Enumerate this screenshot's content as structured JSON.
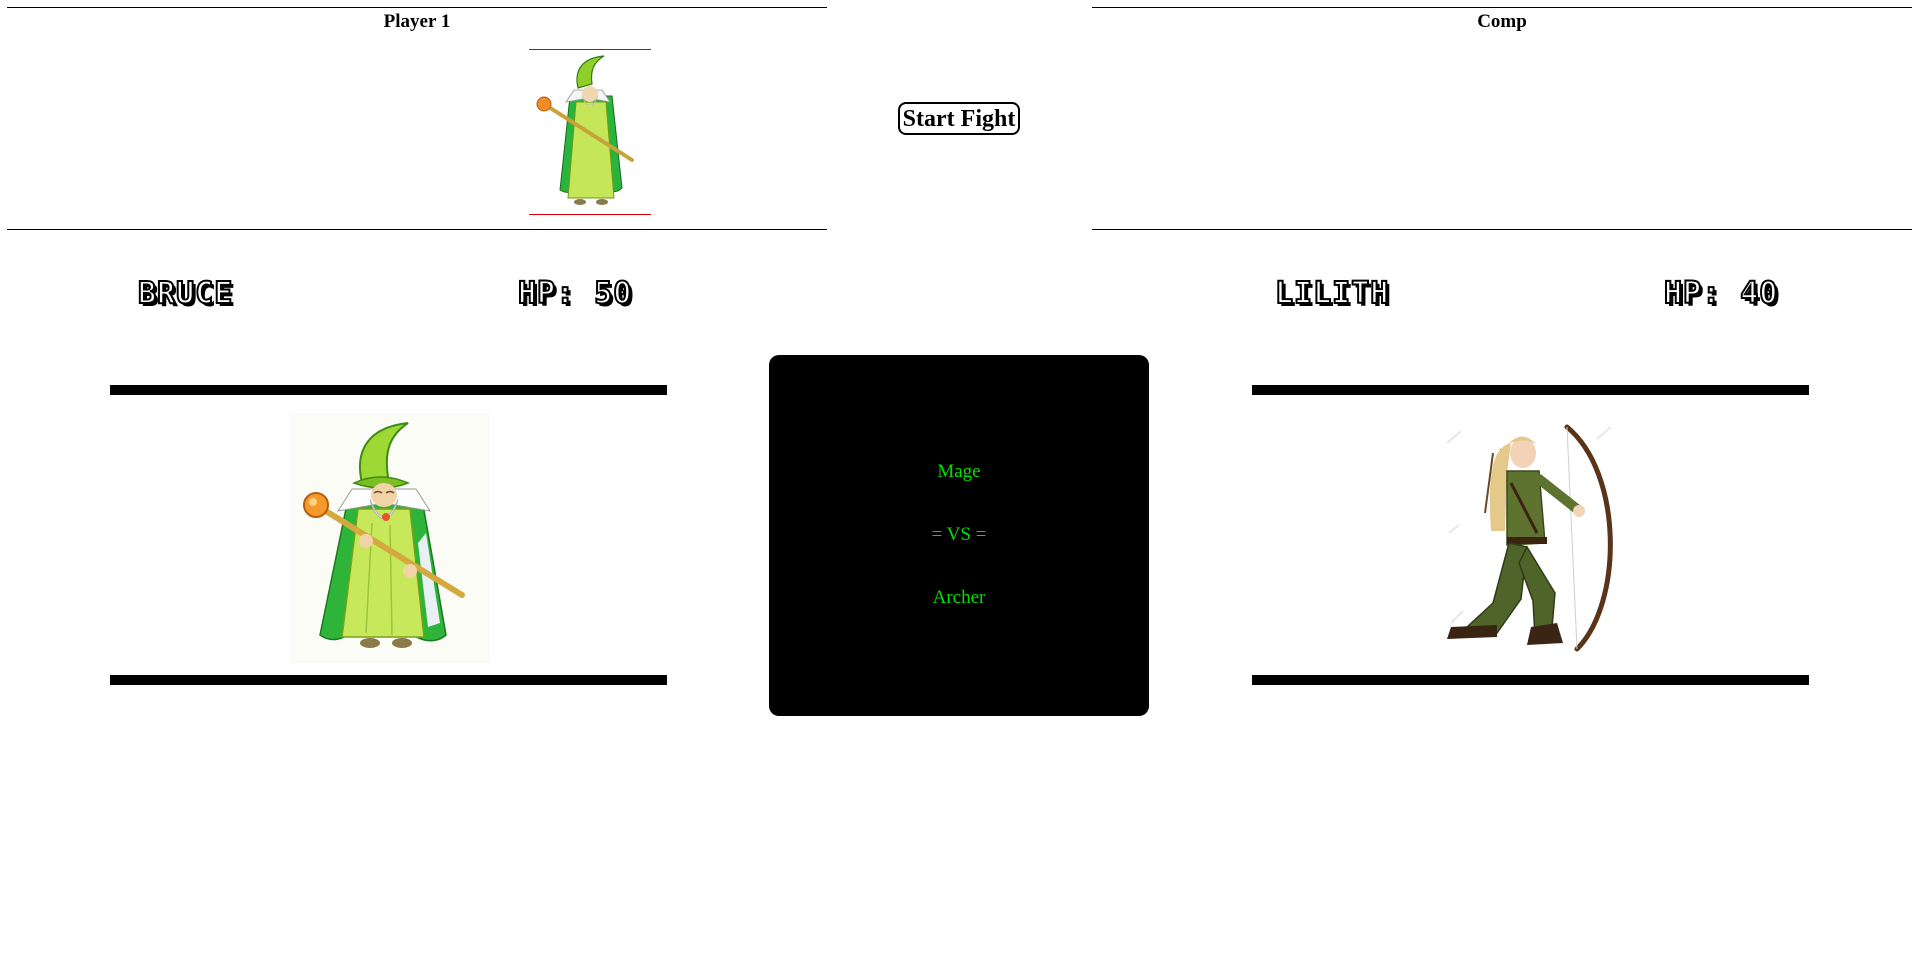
{
  "player_panel": {
    "title": "Player 1",
    "selected_character": "mage-wizard-image"
  },
  "comp_panel": {
    "title": "Comp"
  },
  "start_button": {
    "label": "Start Fight"
  },
  "player": {
    "name": "BRUCE",
    "hp_text": "HP: 50",
    "hp": 50,
    "image": "mage-wizard-image"
  },
  "computer": {
    "name": "LILITH",
    "hp_text": "HP: 40",
    "hp": 40,
    "image": "elf-archer-image"
  },
  "versus": {
    "player_class": "Mage",
    "vs_text": "= VS =",
    "computer_class": "Archer"
  },
  "colors": {
    "versus_background": "#000000",
    "versus_text": "#00e000",
    "thumb_border": "#e00000",
    "wizard_robe": "#9ed834",
    "archer_outfit": "#5a6b2a"
  }
}
